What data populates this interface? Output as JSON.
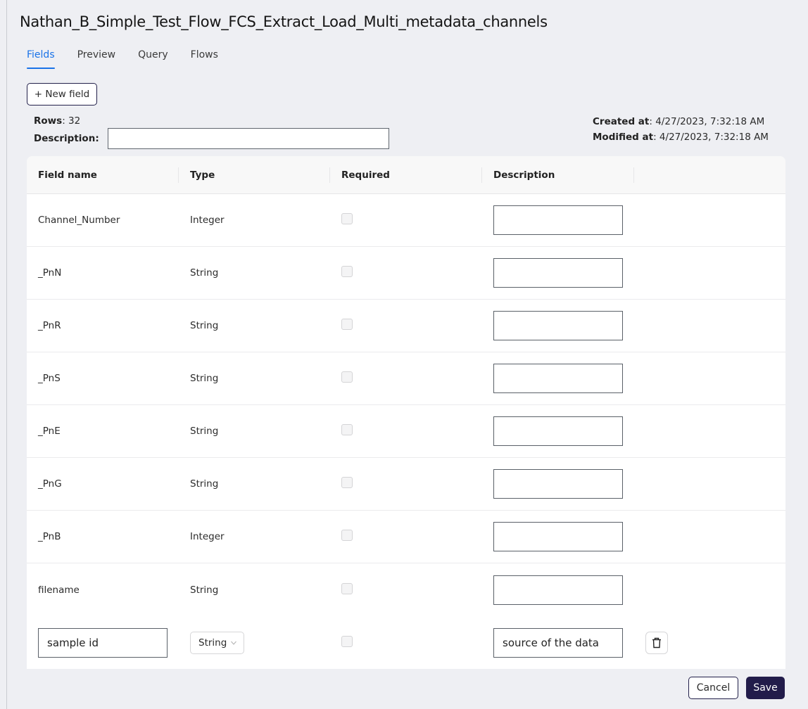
{
  "page": {
    "title": "Nathan_B_Simple_Test_Flow_FCS_Extract_Load_Multi_metadata_channels",
    "accent_color": "#1a73e8",
    "primary_button_color": "#221c4a"
  },
  "tabs": [
    {
      "label": "Fields",
      "active": true
    },
    {
      "label": "Preview",
      "active": false
    },
    {
      "label": "Query",
      "active": false
    },
    {
      "label": "Flows",
      "active": false
    }
  ],
  "toolbar": {
    "new_field_label": "+ New field"
  },
  "meta": {
    "rows_label": "Rows",
    "rows_value": ": 32",
    "description_label": "Description:",
    "description_value": "",
    "created_label": "Created at",
    "created_value": ": 4/27/2023, 7:32:18 AM",
    "modified_label": "Modified at",
    "modified_value": ": 4/27/2023, 7:32:18 AM"
  },
  "table": {
    "columns": [
      "Field name",
      "Type",
      "Required",
      "Description",
      ""
    ],
    "rows": [
      {
        "name": "Channel_Number",
        "type": "Integer",
        "required": false,
        "description": ""
      },
      {
        "name": "_PnN",
        "type": "String",
        "required": false,
        "description": ""
      },
      {
        "name": "_PnR",
        "type": "String",
        "required": false,
        "description": ""
      },
      {
        "name": "_PnS",
        "type": "String",
        "required": false,
        "description": ""
      },
      {
        "name": "_PnE",
        "type": "String",
        "required": false,
        "description": ""
      },
      {
        "name": "_PnG",
        "type": "String",
        "required": false,
        "description": ""
      },
      {
        "name": "_PnB",
        "type": "Integer",
        "required": false,
        "description": ""
      },
      {
        "name": "filename",
        "type": "String",
        "required": false,
        "description": ""
      }
    ],
    "new_row": {
      "name": "sample id",
      "type": "String",
      "required": false,
      "description": "source of the data",
      "delete_icon": "trash-icon"
    }
  },
  "footer": {
    "cancel_label": "Cancel",
    "save_label": "Save"
  }
}
